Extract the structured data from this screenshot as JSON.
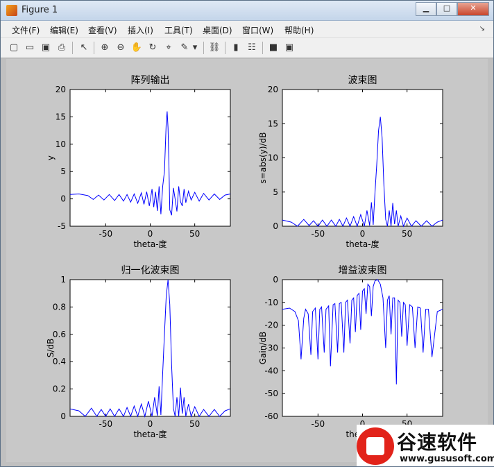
{
  "window": {
    "title": "Figure 1",
    "buttons": [
      "▁",
      "□",
      "✕"
    ]
  },
  "menu": [
    "文件(F)",
    "编辑(E)",
    "查看(V)",
    "插入(I)",
    "工具(T)",
    "桌面(D)",
    "窗口(W)",
    "帮助(H)"
  ],
  "menu_overflow": "↘",
  "toolbar": [
    {
      "icon": "new-figure-icon",
      "glyph": "▢"
    },
    {
      "icon": "open-file-icon",
      "glyph": "▭"
    },
    {
      "icon": "save-icon",
      "glyph": "▣"
    },
    {
      "icon": "print-icon",
      "glyph": "⎙"
    },
    {
      "icon": "pointer-icon",
      "glyph": "↖"
    },
    {
      "icon": "zoom-in-icon",
      "glyph": "⊕"
    },
    {
      "icon": "zoom-out-icon",
      "glyph": "⊖"
    },
    {
      "icon": "pan-icon",
      "glyph": "✋"
    },
    {
      "icon": "rotate-icon",
      "glyph": "↻"
    },
    {
      "icon": "data-cursor-icon",
      "glyph": "⌖"
    },
    {
      "icon": "brush-icon",
      "glyph": "✎"
    },
    {
      "icon": "brush-dropdown-icon",
      "glyph": "▾"
    },
    {
      "icon": "link-icon",
      "glyph": "⛓"
    },
    {
      "icon": "colorbar-icon",
      "glyph": "▮"
    },
    {
      "icon": "legend-icon",
      "glyph": "☷"
    },
    {
      "icon": "hide-tools-icon",
      "glyph": "■"
    },
    {
      "icon": "show-tools-icon",
      "glyph": "▣"
    }
  ],
  "colors": {
    "line": "#0000ff",
    "figure_bg": "#c8c8c8",
    "axes_bg": "#ffffff"
  },
  "watermark": {
    "name": "谷速软件",
    "url": "www.gususoft.com"
  },
  "chart_data": [
    {
      "type": "line",
      "title": "阵列输出",
      "xlabel": "theta-度",
      "ylabel": "y",
      "xlim": [
        -90,
        90
      ],
      "ylim": [
        -5,
        20
      ],
      "xticks": [
        -50,
        0,
        50
      ],
      "yticks": [
        -5,
        0,
        5,
        10,
        15,
        20
      ],
      "series": [
        {
          "x": [
            -90,
            -80,
            -70,
            -64,
            -58,
            -52,
            -46,
            -40,
            -35,
            -30,
            -26,
            -22,
            -18,
            -14,
            -10,
            -7,
            -4,
            -1,
            2,
            4,
            6,
            8,
            10,
            12,
            14,
            16,
            18,
            19,
            20,
            21,
            22,
            24,
            26,
            28,
            30,
            32,
            34,
            36,
            38,
            40,
            43,
            46,
            50,
            55,
            60,
            66,
            72,
            78,
            84,
            90
          ],
          "y": [
            0.8,
            0.9,
            0.6,
            -0.1,
            0.7,
            -0.2,
            0.8,
            -0.3,
            0.8,
            -0.4,
            0.8,
            -0.6,
            0.9,
            -0.8,
            1.1,
            -1.0,
            1.3,
            -1.3,
            1.8,
            -1.5,
            1.3,
            -2.2,
            2.3,
            -2.8,
            2.3,
            5,
            14,
            16,
            13,
            6,
            -2,
            -3,
            2,
            0,
            -2.3,
            2.3,
            -0.5,
            -1.3,
            1.8,
            -0.7,
            1.4,
            -0.2,
            1.2,
            -0.4,
            1.0,
            -0.2,
            0.9,
            -0.1,
            0.7,
            0.9
          ]
        }
      ]
    },
    {
      "type": "line",
      "title": "波束图",
      "xlabel": "theta-度",
      "ylabel": "s=abs(y)/dB",
      "xlim": [
        -90,
        90
      ],
      "ylim": [
        0,
        20
      ],
      "xticks": [
        -50,
        0,
        50
      ],
      "yticks": [
        0,
        5,
        10,
        15,
        20
      ],
      "series": [
        {
          "x": [
            -90,
            -80,
            -73,
            -66,
            -60,
            -55,
            -50,
            -45,
            -40,
            -35,
            -30,
            -26,
            -22,
            -18,
            -14,
            -10,
            -6,
            -2,
            2,
            5,
            8,
            10,
            12,
            14,
            16,
            18,
            20,
            22,
            24,
            26,
            28,
            30,
            32,
            34,
            36,
            38,
            40,
            43,
            46,
            50,
            55,
            60,
            66,
            72,
            78,
            84,
            90
          ],
          "y": [
            0.9,
            0.6,
            0.0,
            1.0,
            0.1,
            0.8,
            0.0,
            0.9,
            0.0,
            0.9,
            0.0,
            1.0,
            0.0,
            1.2,
            0.0,
            1.4,
            0.0,
            1.7,
            0.0,
            2.3,
            0.1,
            3.5,
            0.2,
            5,
            9,
            14,
            16,
            13,
            6,
            1,
            0,
            2.3,
            0,
            3.4,
            0.3,
            2.3,
            0,
            1.5,
            0,
            1.2,
            0,
            0.8,
            0,
            0.8,
            0,
            0.6,
            0.9
          ]
        }
      ]
    },
    {
      "type": "line",
      "title": "归一化波束图",
      "xlabel": "theta-度",
      "ylabel": "S/dB",
      "xlim": [
        -90,
        90
      ],
      "ylim": [
        0,
        1
      ],
      "xticks": [
        -50,
        0,
        50
      ],
      "yticks": [
        0,
        0.2,
        0.4,
        0.6,
        0.8,
        1
      ],
      "series": [
        {
          "x": [
            -90,
            -80,
            -73,
            -66,
            -60,
            -55,
            -50,
            -45,
            -40,
            -35,
            -30,
            -26,
            -22,
            -18,
            -14,
            -10,
            -6,
            -2,
            2,
            5,
            8,
            10,
            12,
            14,
            16,
            18,
            20,
            22,
            24,
            26,
            28,
            30,
            32,
            34,
            36,
            38,
            40,
            43,
            46,
            50,
            55,
            60,
            66,
            72,
            78,
            84,
            90
          ],
          "y": [
            0.055,
            0.04,
            0.0,
            0.06,
            0.0,
            0.05,
            0.0,
            0.055,
            0.0,
            0.055,
            0.0,
            0.065,
            0.0,
            0.075,
            0.0,
            0.09,
            0.0,
            0.11,
            0.0,
            0.14,
            0.005,
            0.22,
            0.01,
            0.32,
            0.6,
            0.88,
            1.0,
            0.82,
            0.38,
            0.06,
            0.0,
            0.14,
            0.0,
            0.21,
            0.02,
            0.14,
            0.0,
            0.09,
            0.0,
            0.07,
            0.0,
            0.05,
            0.0,
            0.05,
            0.0,
            0.04,
            0.055
          ]
        }
      ]
    },
    {
      "type": "line",
      "title": "增益波束图",
      "xlabel": "theta-度",
      "ylabel": "Gain/dB",
      "xlim": [
        -90,
        90
      ],
      "ylim": [
        -60,
        0
      ],
      "xticks": [
        -50,
        0,
        50
      ],
      "yticks": [
        -60,
        -50,
        -40,
        -30,
        -20,
        -10,
        0
      ],
      "series": [
        {
          "x": [
            -90,
            -82,
            -76,
            -72,
            -69,
            -66,
            -64,
            -61,
            -58,
            -56,
            -53,
            -50,
            -48,
            -46,
            -43,
            -41,
            -38,
            -36,
            -33,
            -31,
            -28,
            -26,
            -24,
            -21,
            -19,
            -17,
            -14,
            -12,
            -10,
            -8,
            -6,
            -4,
            -2,
            0,
            2,
            4,
            6,
            8,
            10,
            12,
            14,
            17,
            20,
            23,
            26,
            28,
            30,
            32,
            34,
            36,
            38,
            40,
            42,
            44,
            46,
            48,
            50,
            53,
            56,
            59,
            62,
            65,
            68,
            71,
            74,
            78,
            84,
            90
          ],
          "y": [
            -13,
            -12.5,
            -14,
            -18,
            -35,
            -17,
            -13,
            -15,
            -33,
            -14,
            -12.5,
            -35,
            -13,
            -12,
            -32,
            -13,
            -11.5,
            -38,
            -11,
            -10.5,
            -32,
            -10.5,
            -10,
            -32,
            -10,
            -9,
            -28,
            -9,
            -8,
            -23,
            -7,
            -6,
            -22,
            -5,
            -4,
            -15,
            -2,
            -3,
            -16,
            -3,
            -0.5,
            0,
            -2,
            -8,
            -30,
            -9,
            -7,
            -24,
            -8,
            -8,
            -46,
            -9,
            -10,
            -25,
            -10,
            -11,
            -29,
            -11,
            -12,
            -30,
            -12,
            -12.5,
            -32,
            -13,
            -13,
            -34,
            -14,
            -13
          ]
        }
      ]
    }
  ]
}
